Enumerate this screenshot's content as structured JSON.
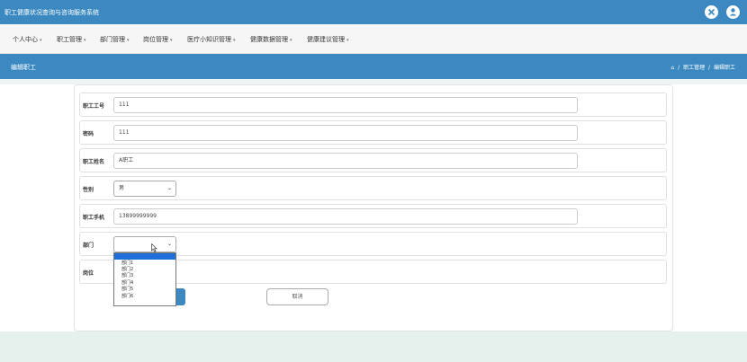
{
  "app": {
    "title": "职工健康状况查询与咨询服务系统",
    "icons": [
      "settings-cross-icon",
      "user-icon"
    ]
  },
  "nav": {
    "items": [
      {
        "label": "个人中心"
      },
      {
        "label": "职工管理"
      },
      {
        "label": "部门管理"
      },
      {
        "label": "岗位管理"
      },
      {
        "label": "医疗小知识管理"
      },
      {
        "label": "健康数据管理"
      },
      {
        "label": "健康建议管理"
      }
    ]
  },
  "header": {
    "page_title": "编辑职工",
    "breadcrumb": [
      "职工管理",
      "编辑职工"
    ],
    "separator": "/"
  },
  "form": {
    "fields": [
      {
        "label": "职工工号",
        "value": "111",
        "type": "text"
      },
      {
        "label": "密码",
        "value": "111",
        "type": "text"
      },
      {
        "label": "职工姓名",
        "value": "A职工",
        "type": "text"
      },
      {
        "label": "性别",
        "value": "男",
        "type": "select"
      },
      {
        "label": "职工手机",
        "value": "13899999999",
        "type": "text"
      },
      {
        "label": "部门",
        "value": "",
        "type": "select"
      },
      {
        "label": "岗位",
        "value": "",
        "type": "select"
      }
    ],
    "department_options": [
      "",
      "部门1",
      "部门2",
      "部门3",
      "部门4",
      "部门5",
      "部门6"
    ],
    "cancel_label": "取消"
  },
  "colors": {
    "primary": "#3b89c0",
    "selected_option": "#1e6fd9"
  }
}
